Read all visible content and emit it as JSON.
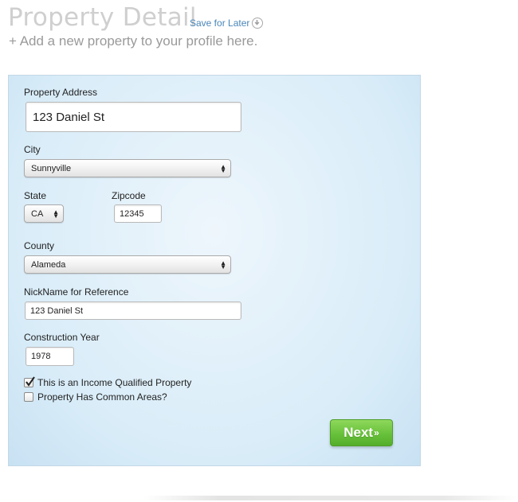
{
  "header": {
    "title": "Property Detail",
    "save_later": "Save for Later",
    "subtitle": "+ Add a new property to your profile here."
  },
  "form": {
    "address": {
      "label": "Property Address",
      "value": "123 Daniel St"
    },
    "city": {
      "label": "City",
      "value": "Sunnyville"
    },
    "state": {
      "label": "State",
      "value": "CA"
    },
    "zipcode": {
      "label": "Zipcode",
      "value": "12345"
    },
    "county": {
      "label": "County",
      "value": "Alameda"
    },
    "nickname": {
      "label": "NickName for Reference",
      "value": "123 Daniel St"
    },
    "construction_year": {
      "label": "Construction Year",
      "value": "1978"
    },
    "income_qualified": {
      "label": "This is an Income Qualified Property",
      "checked": true
    },
    "common_areas": {
      "label": "Property Has Common Areas?",
      "checked": false
    },
    "next_label": "Next",
    "next_suffix": "»"
  },
  "icons": {
    "save": "download-circle-icon",
    "select_arrows": "up-down-arrows-icon",
    "check": "checkmark-icon"
  },
  "colors": {
    "title": "#cfcfcf",
    "link": "#4a86b8",
    "panel": "#d8ecf8",
    "next_button": "#68c13a"
  }
}
